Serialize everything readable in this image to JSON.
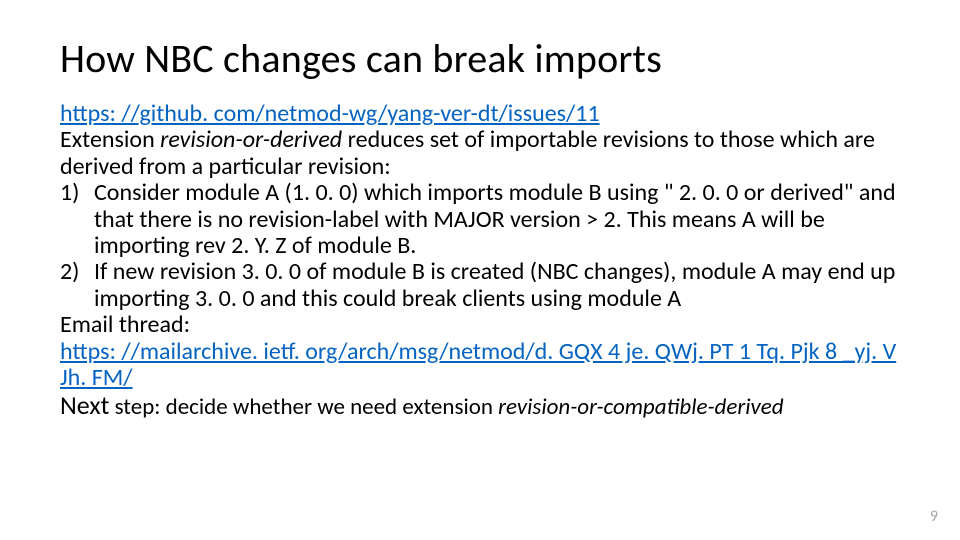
{
  "title": "How NBC changes can break imports",
  "link1": "https: //github. com/netmod-wg/yang-ver-dt/issues/11",
  "intro_pre": "Extension ",
  "intro_em": "revision-or-derived",
  "intro_post": " reduces set of importable revisions to those which are derived from a particular revision:",
  "items": [
    {
      "num": "1)",
      "text": "Consider module A (1. 0. 0) which imports module B using \" 2. 0. 0 or derived\" and that there is no revision-label with MAJOR version > 2. This means A will be importing rev 2. Y. Z of module B."
    },
    {
      "num": "2)",
      "text": "If new revision 3. 0. 0 of module B is created (NBC changes), module A may end up importing 3. 0. 0 and this could break clients using module A"
    }
  ],
  "email_label": "Email thread:",
  "link2": "https: //mailarchive. ietf. org/arch/msg/netmod/d. GQX 4 je. QWj. PT 1 Tq. Pjk 8 _yj. VJh. FM/",
  "next_pre": "Next",
  "next_mid": " step: decide whether we need extension ",
  "next_em": "revision-or-compatible-derived",
  "page_number": "9"
}
